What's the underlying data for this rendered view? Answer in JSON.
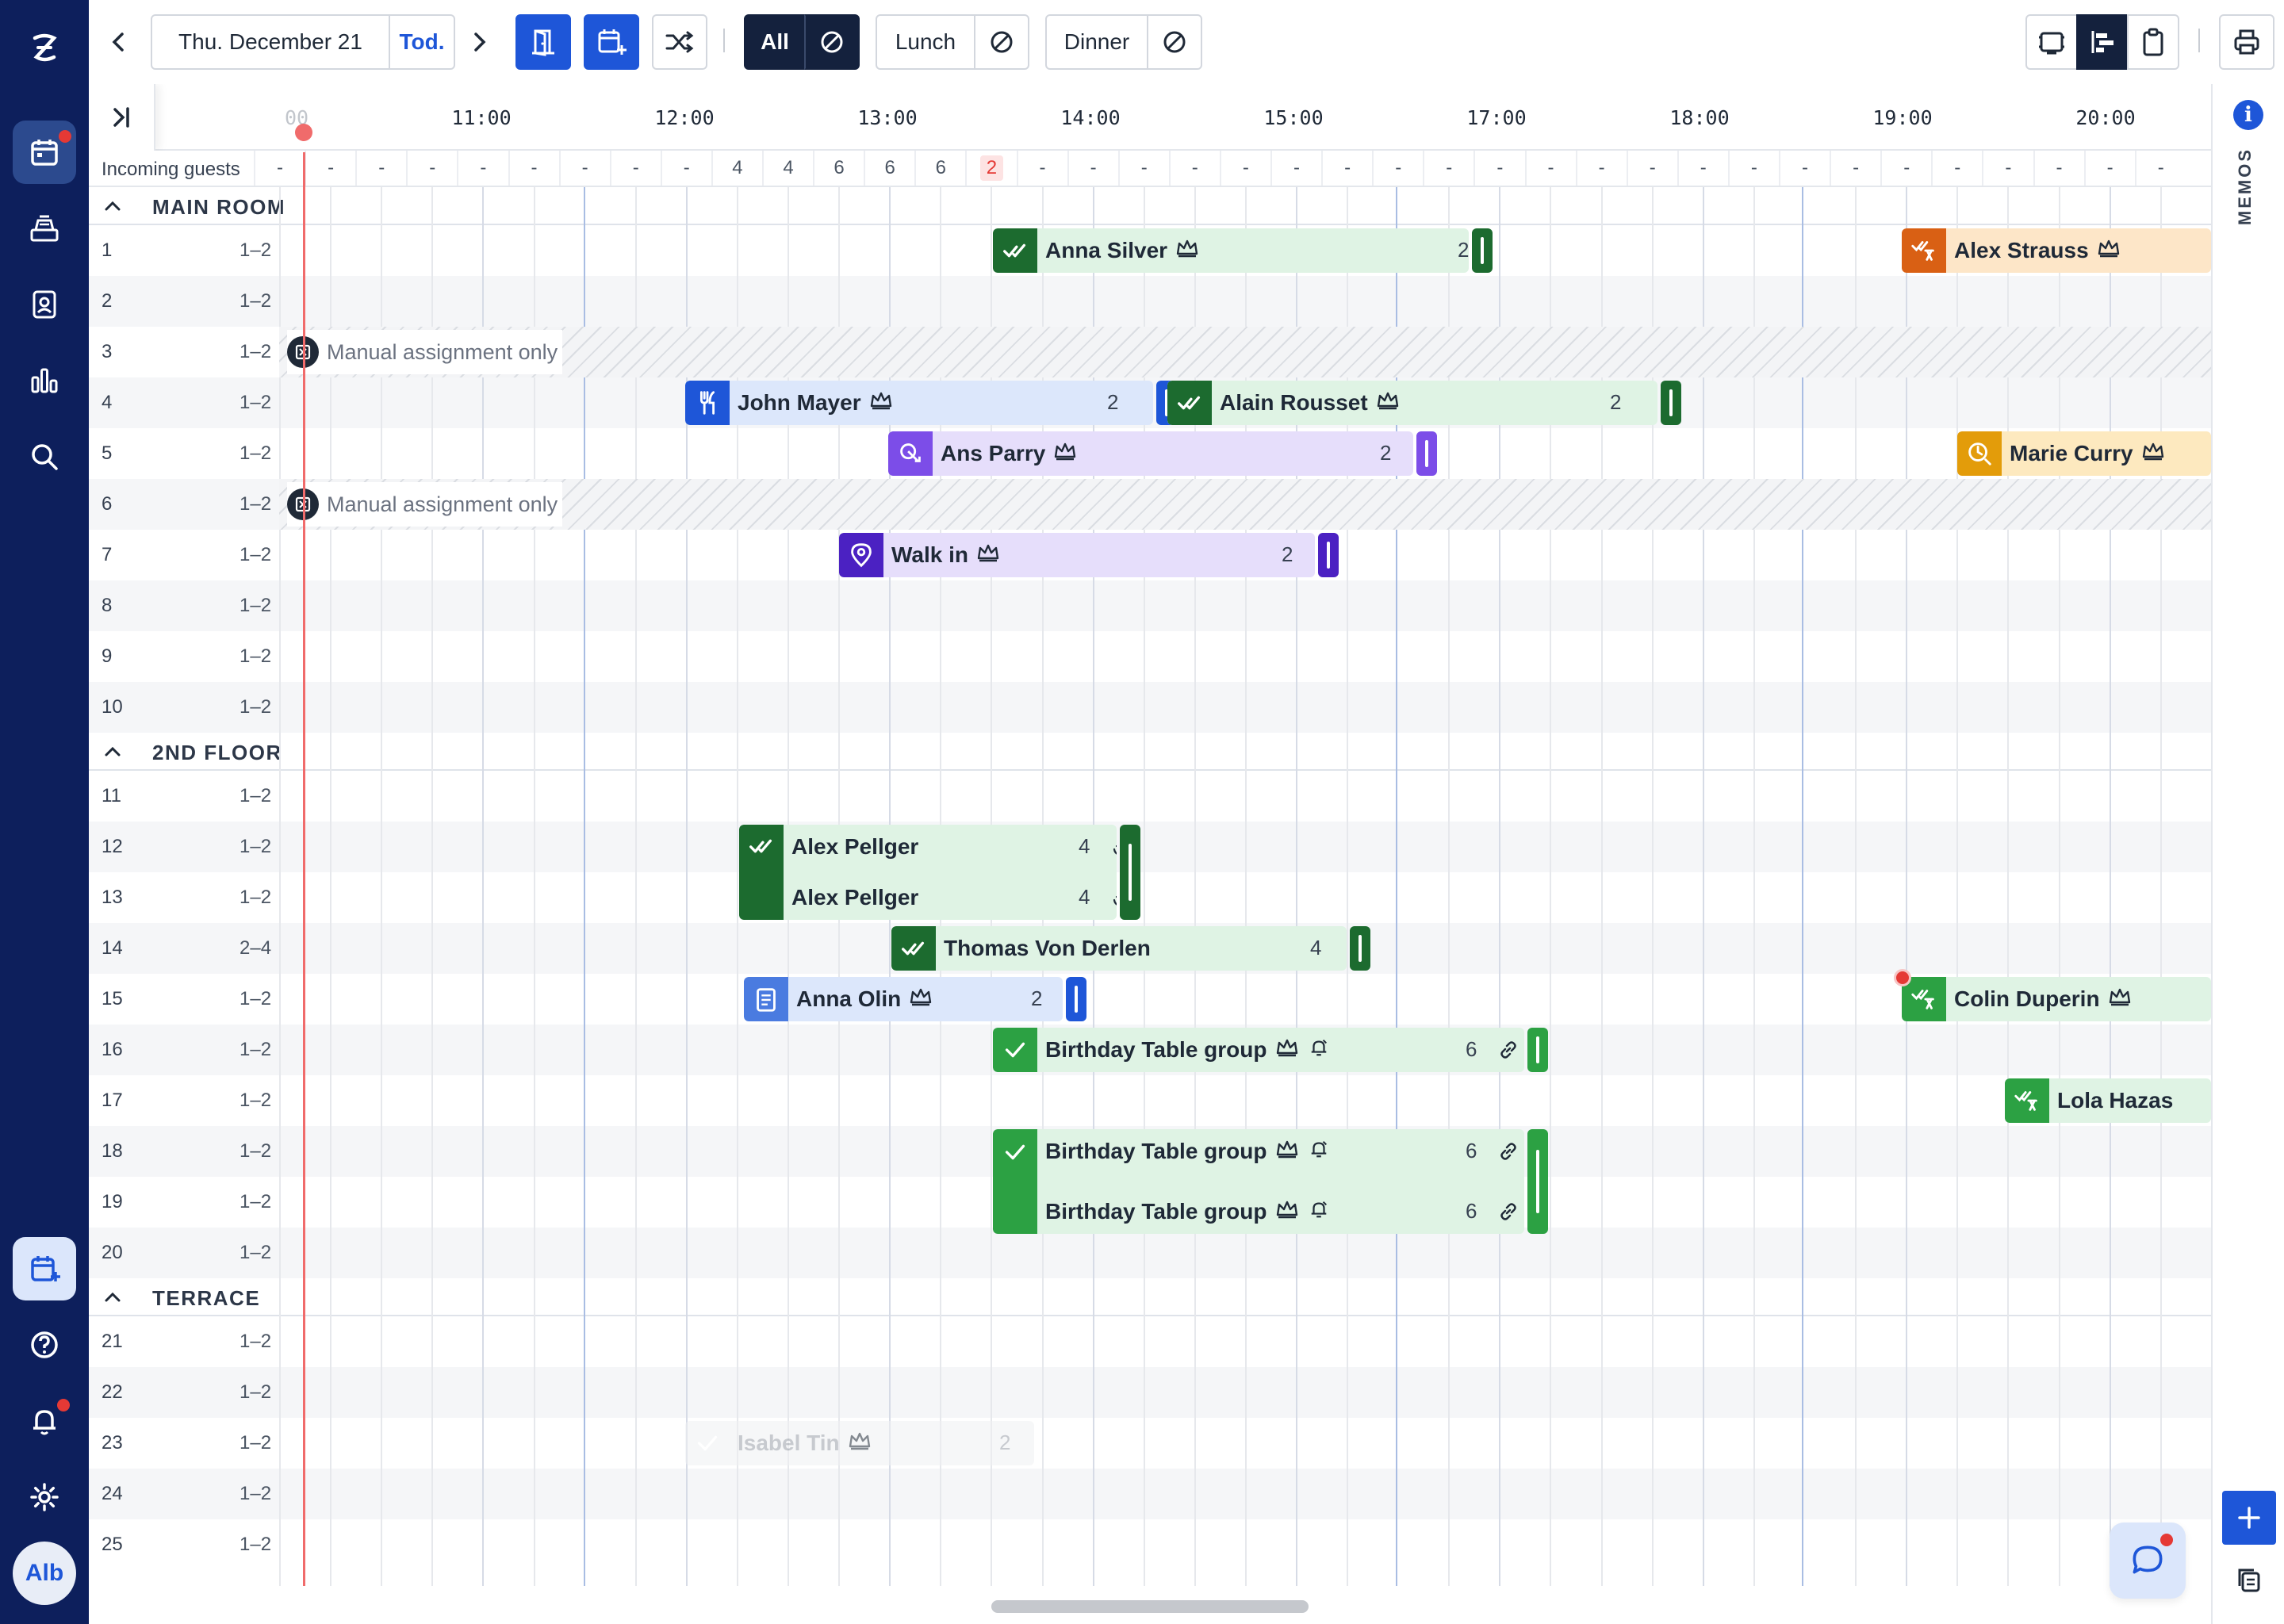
{
  "toolbar": {
    "date": "Thu. December 21",
    "today": "Tod.",
    "filters": [
      "All",
      "Lunch",
      "Dinner"
    ]
  },
  "timeline": {
    "hours": [
      "11:00",
      "12:00",
      "13:00",
      "14:00",
      "15:00",
      "17:00",
      "18:00",
      "19:00",
      "20:00"
    ],
    "partial_label": "00"
  },
  "incoming": {
    "label": "Incoming guests",
    "values": [
      "-",
      "-",
      "-",
      "-",
      "-",
      "-",
      "-",
      "-",
      "-",
      "4",
      "4",
      "6",
      "6",
      "6",
      "2",
      "-",
      "-",
      "-",
      "-",
      "-",
      "-",
      "-",
      "-",
      "-",
      "-",
      "-",
      "-",
      "-",
      "-",
      "-",
      "-",
      "-",
      "-",
      "-",
      "-",
      "-",
      "-",
      "-"
    ]
  },
  "sections": [
    {
      "name": "MAIN ROOM",
      "tables": [
        {
          "num": "1",
          "cap": "1–2"
        },
        {
          "num": "2",
          "cap": "1–2"
        },
        {
          "num": "3",
          "cap": "1–2"
        },
        {
          "num": "4",
          "cap": "1–2"
        },
        {
          "num": "5",
          "cap": "1–2"
        },
        {
          "num": "6",
          "cap": "1–2"
        },
        {
          "num": "7",
          "cap": "1–2"
        },
        {
          "num": "8",
          "cap": "1–2"
        },
        {
          "num": "9",
          "cap": "1–2"
        },
        {
          "num": "10",
          "cap": "1–2"
        }
      ]
    },
    {
      "name": "2ND FLOOR",
      "tables": [
        {
          "num": "11",
          "cap": "1–2"
        },
        {
          "num": "12",
          "cap": "1–2"
        },
        {
          "num": "13",
          "cap": "1–2"
        },
        {
          "num": "14",
          "cap": "2–4"
        },
        {
          "num": "15",
          "cap": "1–2"
        },
        {
          "num": "16",
          "cap": "1–2"
        },
        {
          "num": "17",
          "cap": "1–2"
        },
        {
          "num": "18",
          "cap": "1–2"
        },
        {
          "num": "19",
          "cap": "1–2"
        },
        {
          "num": "20",
          "cap": "1–2"
        }
      ]
    },
    {
      "name": "TERRACE",
      "tables": [
        {
          "num": "21",
          "cap": "1–2"
        },
        {
          "num": "22",
          "cap": "1–2"
        },
        {
          "num": "23",
          "cap": "1–2"
        },
        {
          "num": "24",
          "cap": "1–2"
        },
        {
          "num": "25",
          "cap": "1–2"
        }
      ]
    }
  ],
  "manual_assignment": "Manual assignment only",
  "reservations": {
    "anna_silver": {
      "name": "Anna Silver",
      "count": "2"
    },
    "alex_strauss": {
      "name": "Alex Strauss"
    },
    "john_mayer": {
      "name": "John Mayer",
      "count": "2"
    },
    "alain_rousset": {
      "name": "Alain Rousset",
      "count": "2"
    },
    "ans_parry": {
      "name": "Ans Parry",
      "count": "2"
    },
    "marie_curry": {
      "name": "Marie Curry"
    },
    "walk_in": {
      "name": "Walk in",
      "count": "2"
    },
    "alex_pellger_1": {
      "name": "Alex Pellger",
      "count": "4"
    },
    "alex_pellger_2": {
      "name": "Alex Pellger",
      "count": "4"
    },
    "thomas": {
      "name": "Thomas Von Derlen",
      "count": "4"
    },
    "anna_olin": {
      "name": "Anna Olin",
      "count": "2"
    },
    "colin": {
      "name": "Colin Duperin"
    },
    "birthday_1": {
      "name": "Birthday Table group",
      "count": "6"
    },
    "lola": {
      "name": "Lola Hazas"
    },
    "birthday_2": {
      "name": "Birthday Table group",
      "count": "6"
    },
    "birthday_3": {
      "name": "Birthday Table group",
      "count": "6"
    },
    "isabel": {
      "name": "Isabel  Tin",
      "count": "2"
    }
  },
  "memos": {
    "label": "MEMOS",
    "info": "i"
  },
  "user": {
    "initials": "Alb"
  },
  "colors": {
    "sidebar": "#0d1f5c",
    "accent": "#1e56d8",
    "now_line": "#f06b6b"
  }
}
